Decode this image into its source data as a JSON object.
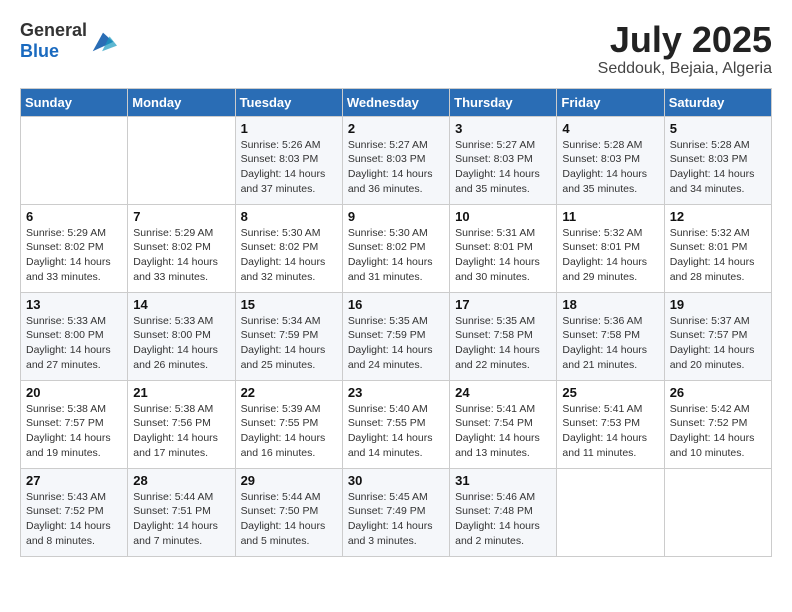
{
  "header": {
    "logo_general": "General",
    "logo_blue": "Blue",
    "month": "July 2025",
    "location": "Seddouk, Bejaia, Algeria"
  },
  "weekdays": [
    "Sunday",
    "Monday",
    "Tuesday",
    "Wednesday",
    "Thursday",
    "Friday",
    "Saturday"
  ],
  "weeks": [
    [
      {
        "day": "",
        "info": ""
      },
      {
        "day": "",
        "info": ""
      },
      {
        "day": "1",
        "info": "Sunrise: 5:26 AM\nSunset: 8:03 PM\nDaylight: 14 hours and 37 minutes."
      },
      {
        "day": "2",
        "info": "Sunrise: 5:27 AM\nSunset: 8:03 PM\nDaylight: 14 hours and 36 minutes."
      },
      {
        "day": "3",
        "info": "Sunrise: 5:27 AM\nSunset: 8:03 PM\nDaylight: 14 hours and 35 minutes."
      },
      {
        "day": "4",
        "info": "Sunrise: 5:28 AM\nSunset: 8:03 PM\nDaylight: 14 hours and 35 minutes."
      },
      {
        "day": "5",
        "info": "Sunrise: 5:28 AM\nSunset: 8:03 PM\nDaylight: 14 hours and 34 minutes."
      }
    ],
    [
      {
        "day": "6",
        "info": "Sunrise: 5:29 AM\nSunset: 8:02 PM\nDaylight: 14 hours and 33 minutes."
      },
      {
        "day": "7",
        "info": "Sunrise: 5:29 AM\nSunset: 8:02 PM\nDaylight: 14 hours and 33 minutes."
      },
      {
        "day": "8",
        "info": "Sunrise: 5:30 AM\nSunset: 8:02 PM\nDaylight: 14 hours and 32 minutes."
      },
      {
        "day": "9",
        "info": "Sunrise: 5:30 AM\nSunset: 8:02 PM\nDaylight: 14 hours and 31 minutes."
      },
      {
        "day": "10",
        "info": "Sunrise: 5:31 AM\nSunset: 8:01 PM\nDaylight: 14 hours and 30 minutes."
      },
      {
        "day": "11",
        "info": "Sunrise: 5:32 AM\nSunset: 8:01 PM\nDaylight: 14 hours and 29 minutes."
      },
      {
        "day": "12",
        "info": "Sunrise: 5:32 AM\nSunset: 8:01 PM\nDaylight: 14 hours and 28 minutes."
      }
    ],
    [
      {
        "day": "13",
        "info": "Sunrise: 5:33 AM\nSunset: 8:00 PM\nDaylight: 14 hours and 27 minutes."
      },
      {
        "day": "14",
        "info": "Sunrise: 5:33 AM\nSunset: 8:00 PM\nDaylight: 14 hours and 26 minutes."
      },
      {
        "day": "15",
        "info": "Sunrise: 5:34 AM\nSunset: 7:59 PM\nDaylight: 14 hours and 25 minutes."
      },
      {
        "day": "16",
        "info": "Sunrise: 5:35 AM\nSunset: 7:59 PM\nDaylight: 14 hours and 24 minutes."
      },
      {
        "day": "17",
        "info": "Sunrise: 5:35 AM\nSunset: 7:58 PM\nDaylight: 14 hours and 22 minutes."
      },
      {
        "day": "18",
        "info": "Sunrise: 5:36 AM\nSunset: 7:58 PM\nDaylight: 14 hours and 21 minutes."
      },
      {
        "day": "19",
        "info": "Sunrise: 5:37 AM\nSunset: 7:57 PM\nDaylight: 14 hours and 20 minutes."
      }
    ],
    [
      {
        "day": "20",
        "info": "Sunrise: 5:38 AM\nSunset: 7:57 PM\nDaylight: 14 hours and 19 minutes."
      },
      {
        "day": "21",
        "info": "Sunrise: 5:38 AM\nSunset: 7:56 PM\nDaylight: 14 hours and 17 minutes."
      },
      {
        "day": "22",
        "info": "Sunrise: 5:39 AM\nSunset: 7:55 PM\nDaylight: 14 hours and 16 minutes."
      },
      {
        "day": "23",
        "info": "Sunrise: 5:40 AM\nSunset: 7:55 PM\nDaylight: 14 hours and 14 minutes."
      },
      {
        "day": "24",
        "info": "Sunrise: 5:41 AM\nSunset: 7:54 PM\nDaylight: 14 hours and 13 minutes."
      },
      {
        "day": "25",
        "info": "Sunrise: 5:41 AM\nSunset: 7:53 PM\nDaylight: 14 hours and 11 minutes."
      },
      {
        "day": "26",
        "info": "Sunrise: 5:42 AM\nSunset: 7:52 PM\nDaylight: 14 hours and 10 minutes."
      }
    ],
    [
      {
        "day": "27",
        "info": "Sunrise: 5:43 AM\nSunset: 7:52 PM\nDaylight: 14 hours and 8 minutes."
      },
      {
        "day": "28",
        "info": "Sunrise: 5:44 AM\nSunset: 7:51 PM\nDaylight: 14 hours and 7 minutes."
      },
      {
        "day": "29",
        "info": "Sunrise: 5:44 AM\nSunset: 7:50 PM\nDaylight: 14 hours and 5 minutes."
      },
      {
        "day": "30",
        "info": "Sunrise: 5:45 AM\nSunset: 7:49 PM\nDaylight: 14 hours and 3 minutes."
      },
      {
        "day": "31",
        "info": "Sunrise: 5:46 AM\nSunset: 7:48 PM\nDaylight: 14 hours and 2 minutes."
      },
      {
        "day": "",
        "info": ""
      },
      {
        "day": "",
        "info": ""
      }
    ]
  ]
}
